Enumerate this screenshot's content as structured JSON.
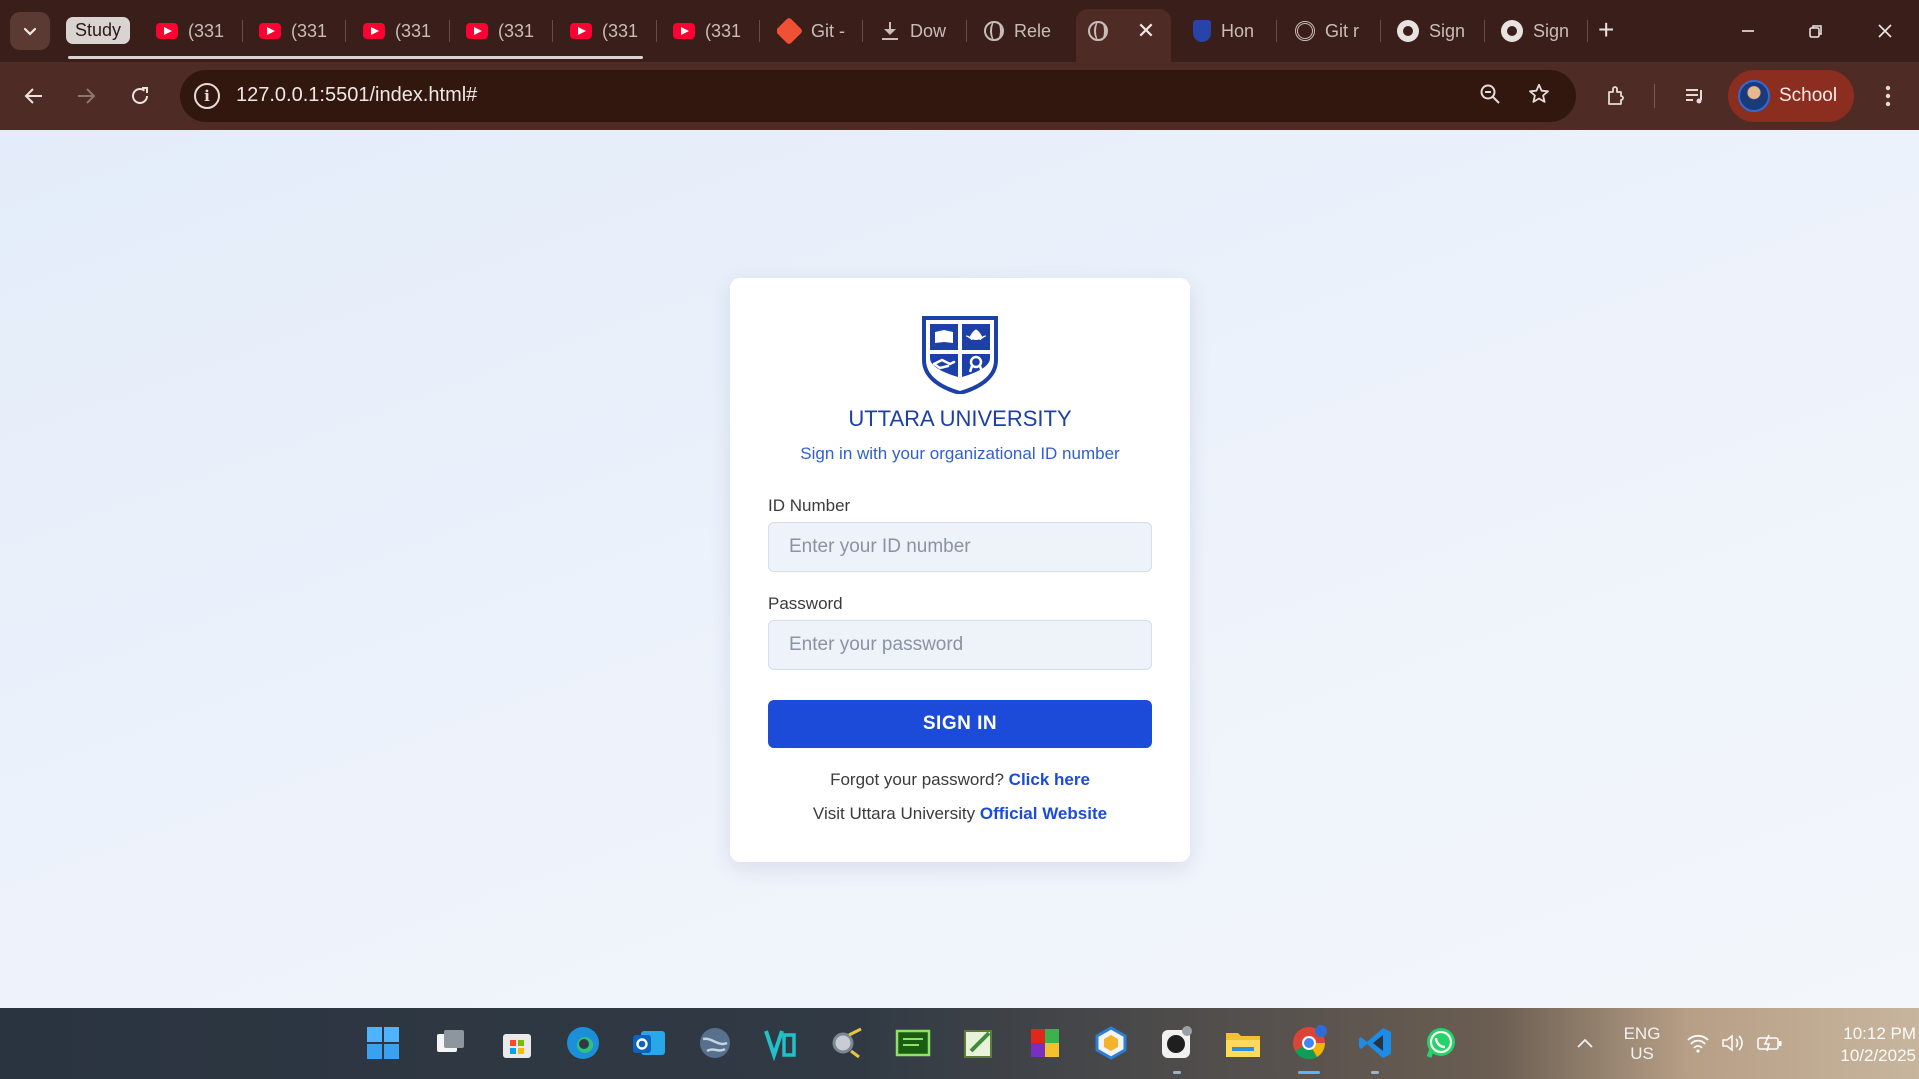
{
  "browser": {
    "tab_group_label": "Study",
    "tabs": [
      {
        "label": "(331",
        "icon": "youtube-icon"
      },
      {
        "label": "(331",
        "icon": "youtube-icon"
      },
      {
        "label": "(331",
        "icon": "youtube-icon"
      },
      {
        "label": "(331",
        "icon": "youtube-icon"
      },
      {
        "label": "(331",
        "icon": "youtube-icon"
      },
      {
        "label": "(331",
        "icon": "youtube-icon"
      },
      {
        "label": "Git -",
        "icon": "git-icon"
      },
      {
        "label": "Dow",
        "icon": "download-icon"
      },
      {
        "label": "Rele",
        "icon": "globe-icon"
      },
      {
        "label": "",
        "icon": "globe-icon",
        "active": true
      },
      {
        "label": "Hon",
        "icon": "university-shield-icon"
      },
      {
        "label": "Git r",
        "icon": "openai-icon"
      },
      {
        "label": "Sign",
        "icon": "github-icon"
      },
      {
        "label": "Sign",
        "icon": "github-icon"
      }
    ],
    "address": "127.0.0.1:5501/index.html#",
    "profile_label": "School",
    "accent_color": "#4e2b24"
  },
  "login": {
    "title": "UTTARA UNIVERSITY",
    "subtitle": "Sign in with your organizational ID number",
    "id_label": "ID Number",
    "id_placeholder": "Enter your ID number",
    "id_value": "",
    "password_label": "Password",
    "password_placeholder": "Enter your password",
    "password_value": "",
    "submit_label": "SIGN IN",
    "forgot_text": "Forgot your password?",
    "forgot_link": "Click here",
    "visit_text": "Visit Uttara University",
    "visit_link": "Official Website",
    "brand_color": "#1c4bd9"
  },
  "taskbar": {
    "apps": [
      "start-icon",
      "task-view-icon",
      "store-icon",
      "edge-icon",
      "outlook-icon",
      "browser-globe-icon",
      "vb-studio-icon",
      "search-tool-icon",
      "terminal-icon",
      "notes-icon",
      "office-icon",
      "box-app-icon",
      "github-desktop-icon",
      "file-explorer-icon",
      "chrome-icon",
      "vscode-icon",
      "whatsapp-icon"
    ],
    "language_top": "ENG",
    "language_bottom": "US",
    "time": "10:12 PM",
    "date": "10/2/2025"
  }
}
